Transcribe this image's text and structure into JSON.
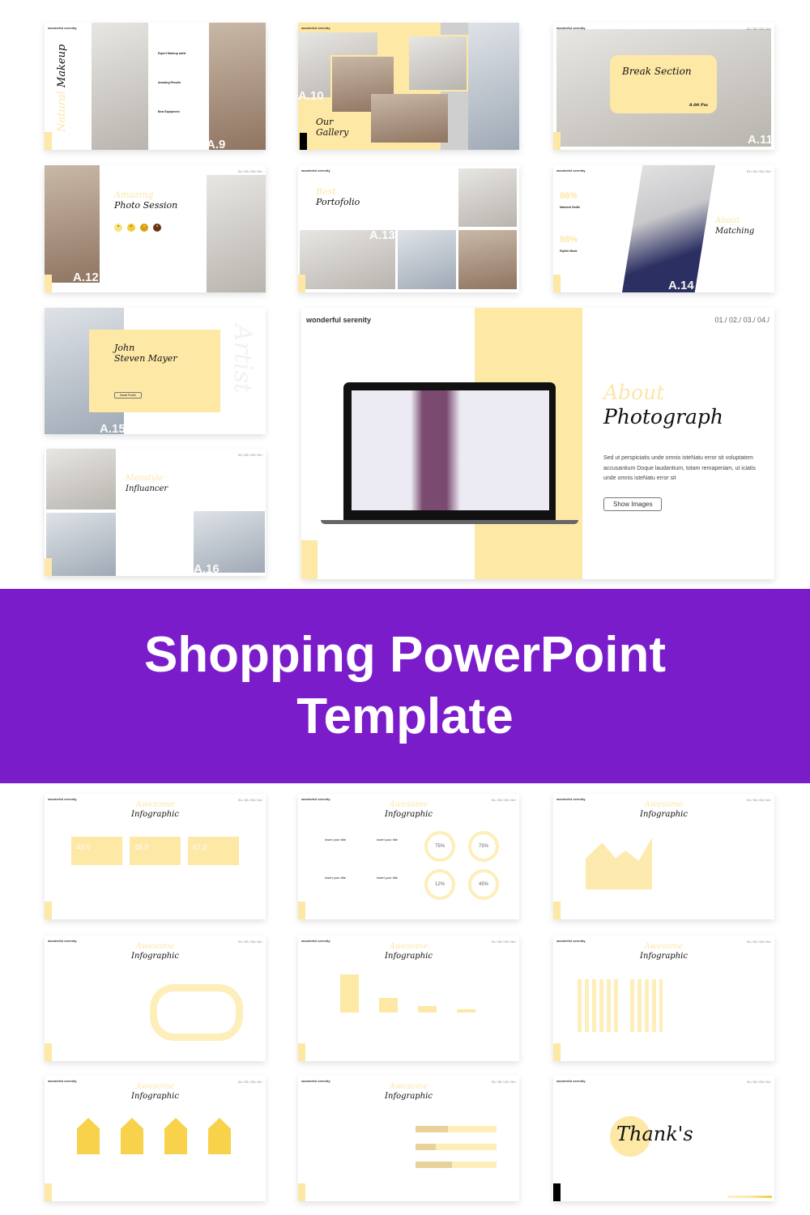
{
  "brand": "wonderful serenity",
  "slide_numbers": "01./ 02./ 03./ 04./",
  "accent": "#fde8a6",
  "banner_color": "#7b1ccb",
  "banner": {
    "title": "Shopping PowerPoint Template"
  },
  "slides": {
    "a9": {
      "title_yellow": "Natural",
      "title_black": "Makeup",
      "items": [
        "Expert Makeup artist",
        "Amazing Results",
        "Best Equipment"
      ],
      "label": "A.9"
    },
    "a10": {
      "title_line1": "Our",
      "title_line2": "Gallery",
      "label": "A.10"
    },
    "a11": {
      "title": "Break Section",
      "price": "8.00 Pm",
      "label": "A.11"
    },
    "a12": {
      "title_yellow": "Amazing",
      "title_black": "Photo Session",
      "dots": [
        "a",
        "b",
        "c",
        "d"
      ],
      "label": "A.12"
    },
    "a13": {
      "title_yellow": "Best",
      "title_black": "Portofolio",
      "label": "A.13"
    },
    "a14": {
      "stat1": "86%",
      "stat1_label": "Matched Stuffs",
      "stat2": "98%",
      "stat2_label": "Stylish Mode",
      "title_yellow": "About",
      "title_black": "Matching",
      "label": "A.14"
    },
    "a15": {
      "name_line1": "John",
      "name_line2": "Steven Mayer",
      "button": "Detail Profile",
      "watermark": "Artist",
      "label": "A.15"
    },
    "a16": {
      "title_yellow": "Menstyle",
      "title_black": "Influancer",
      "label": "A.16"
    },
    "featured": {
      "title_yellow": "About",
      "title_black": "Photograph",
      "body": "Sed ut perspiciatis unde omnis isteNatu error sit voluptatem accusantium Doque laudantium, totam remaperiam, ut iciatis unde omnis isteNatu error sit",
      "button": "Show Images"
    },
    "info": {
      "title_yellow": "Awesome",
      "title_black": "Infographic",
      "boxes": [
        "42.0",
        "45.0",
        "67.0"
      ],
      "item_title": "insert your title",
      "rings": [
        "75%",
        "75%",
        "12%",
        "45%"
      ]
    },
    "thanks": {
      "title": "Thank's"
    }
  }
}
